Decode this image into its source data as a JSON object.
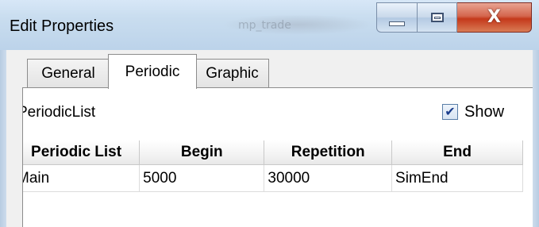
{
  "window": {
    "title": "Edit Properties",
    "background_title": "mp_trade"
  },
  "caption_buttons": {
    "minimize_icon": "minimize-icon",
    "maximize_icon": "maximize-icon",
    "close_icon": "close-icon",
    "close_glyph": "X"
  },
  "tabs": [
    {
      "label": "General",
      "selected": false
    },
    {
      "label": "Periodic",
      "selected": true
    },
    {
      "label": "Graphic",
      "selected": false
    }
  ],
  "panel": {
    "list_label": "PeriodicList",
    "show_checkbox": {
      "label": "Show",
      "checked": true
    }
  },
  "table": {
    "headers": [
      "Periodic List",
      "Begin",
      "Repetition",
      "End"
    ],
    "rows": [
      [
        "Main",
        "5000",
        "30000",
        "SimEnd"
      ]
    ]
  },
  "colors": {
    "close_button": "#c4391b",
    "titlebar": "#c9ddef"
  }
}
